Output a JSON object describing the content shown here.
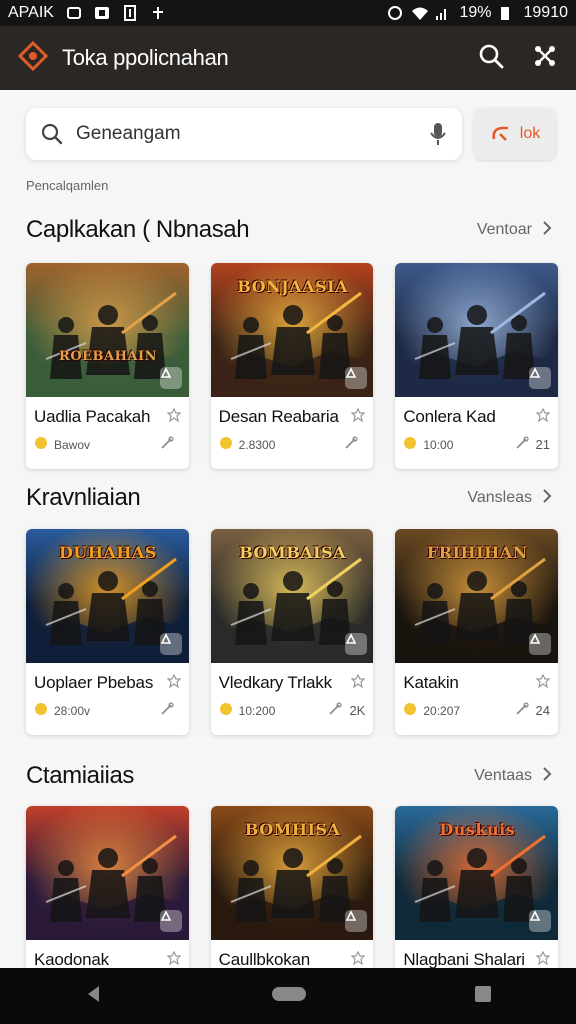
{
  "status_bar": {
    "left_text": "APAIK",
    "battery": "19%",
    "time": "19910"
  },
  "app_bar": {
    "title": "Toka ppolicnahan"
  },
  "search": {
    "value": "Geneangam",
    "action_label": "lok"
  },
  "hint": "Pencalqamlen",
  "sections": [
    {
      "title": "Caplkakan ( Nbnasah",
      "more": "Ventoar",
      "cards": [
        {
          "name": "Uadlia Pacakah",
          "meta": "Bawov",
          "count": "",
          "art": "ROEBAHAIN",
          "palette": [
            "#3b5d3a",
            "#a0632e",
            "#e2a04a"
          ]
        },
        {
          "name": "Desan Reabaria",
          "meta": "2.8300",
          "count": "",
          "art": "BONJAASIA",
          "palette": [
            "#3b2416",
            "#b3431e",
            "#f2b540"
          ]
        },
        {
          "name": "Conlera Kad",
          "meta": "10:00",
          "count": "21",
          "art": "",
          "palette": [
            "#1e2a45",
            "#3d5a8a",
            "#9db8e0"
          ]
        }
      ]
    },
    {
      "title": "Kravnliaian",
      "more": "Vansleas",
      "cards": [
        {
          "name": "Uoplaer Pbebas",
          "meta": "28:00v",
          "count": "",
          "art": "DUHAHAS",
          "palette": [
            "#0f1f3a",
            "#2a5b9c",
            "#f0a020"
          ]
        },
        {
          "name": "Vledkary Trlakk",
          "meta": "10:200",
          "count": "2K",
          "art": "BOMBAISA",
          "palette": [
            "#2a2a2a",
            "#7a6040",
            "#f0d060"
          ]
        },
        {
          "name": "Katakin",
          "meta": "20:207",
          "count": "24",
          "art": "FRIHIHAN",
          "palette": [
            "#1a140e",
            "#6a4a22",
            "#e0a040"
          ]
        }
      ]
    },
    {
      "title": "Ctamiaiias",
      "more": "Ventaas",
      "cards": [
        {
          "name": "Kaodonak",
          "meta": "",
          "count": "",
          "art": "",
          "palette": [
            "#2a1a3a",
            "#c0402a",
            "#f09040"
          ]
        },
        {
          "name": "Caullbkokan",
          "meta": "",
          "count": "",
          "art": "BOMHISA",
          "palette": [
            "#2a1a0e",
            "#8a4a18",
            "#f0b040"
          ]
        },
        {
          "name": "Nlagbani Shalari",
          "meta": "",
          "count": "",
          "art": "Duskuis",
          "palette": [
            "#0e2a3a",
            "#2a6a9a",
            "#f07030"
          ]
        }
      ]
    }
  ],
  "colors": {
    "accent": "#e35a2a",
    "appbar": "#2b2724",
    "background": "#f6f6f6"
  },
  "icons": [
    "app-logo-icon",
    "search-icon",
    "share-icon",
    "mic-icon",
    "back-icon",
    "home-icon",
    "recents-icon"
  ]
}
